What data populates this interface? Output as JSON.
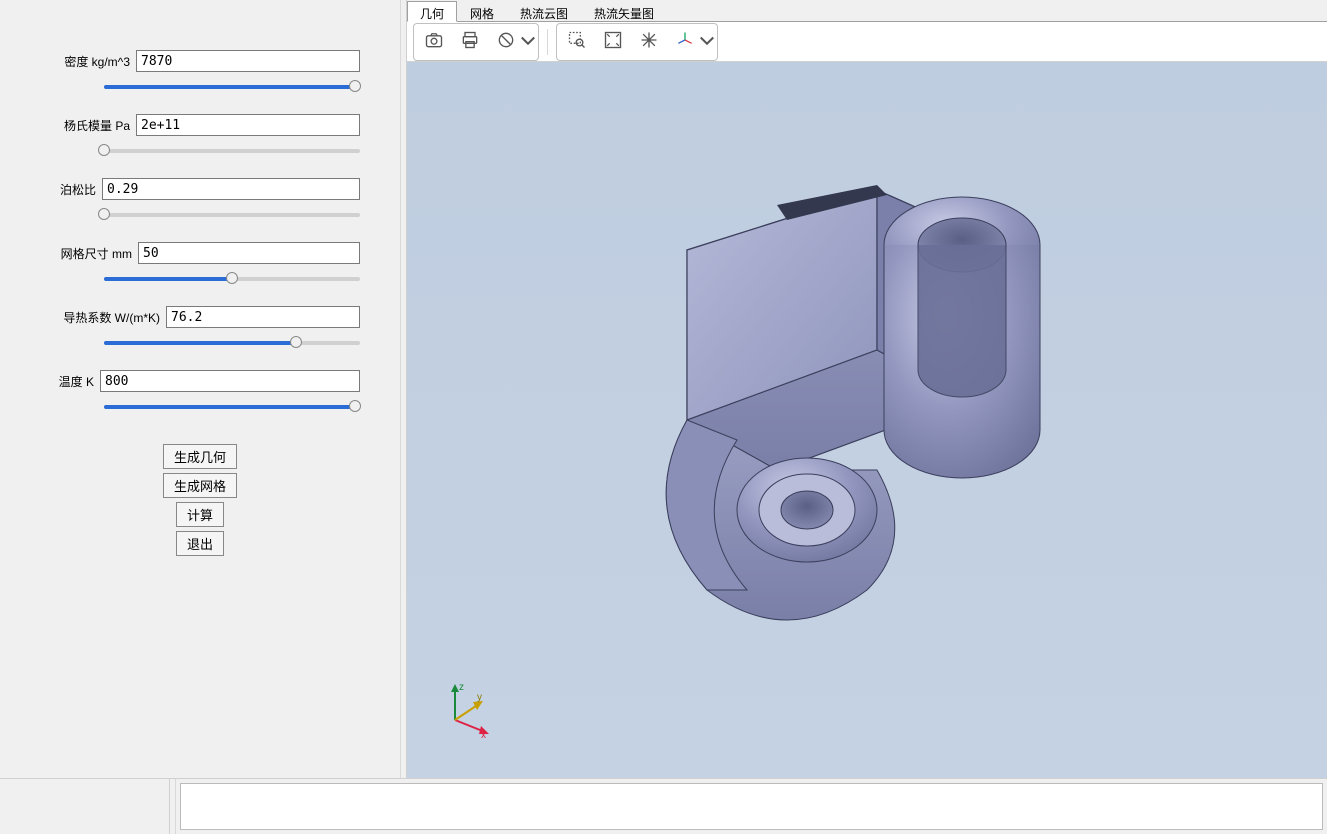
{
  "sidebar": {
    "params": [
      {
        "label": "密度 kg/m^3",
        "value": "7870",
        "slider_pct": 98,
        "indent": 64
      },
      {
        "label": "杨氏模量 Pa",
        "value": "2e+11",
        "slider_pct": 0,
        "indent": 64
      },
      {
        "label": "泊松比",
        "value": "0.29",
        "slider_pct": 0,
        "indent": 64
      },
      {
        "label": "网格尺寸 mm",
        "value": "50",
        "slider_pct": 50,
        "indent": 64
      },
      {
        "label": "导热系数 W/(m*K)",
        "value": "76.2",
        "slider_pct": 75,
        "indent": 64
      },
      {
        "label": "温度 K",
        "value": "800",
        "slider_pct": 98,
        "indent": 64
      }
    ],
    "buttons": {
      "gen_geom": "生成几何",
      "gen_mesh": "生成网格",
      "compute": "计算",
      "exit": "退出"
    }
  },
  "tabs": {
    "items": [
      {
        "label": "几何",
        "active": true
      },
      {
        "label": "网格",
        "active": false
      },
      {
        "label": "热流云图",
        "active": false
      },
      {
        "label": "热流矢量图",
        "active": false
      }
    ]
  },
  "axis": {
    "x": "x",
    "y": "y",
    "z": "z"
  }
}
